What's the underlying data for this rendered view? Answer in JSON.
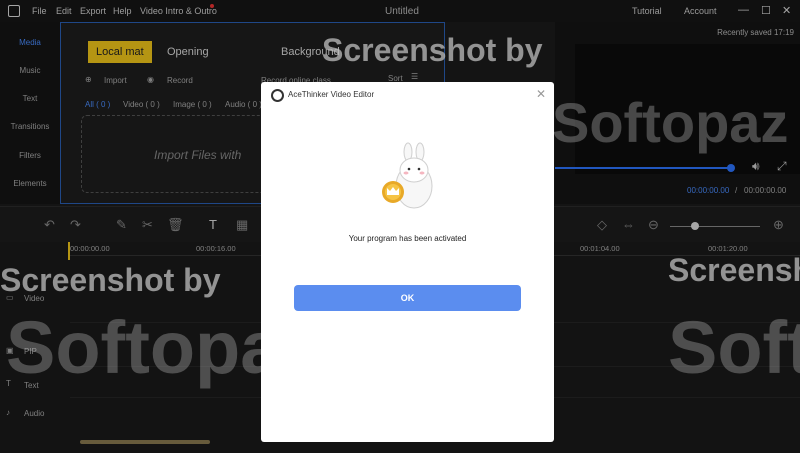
{
  "window": {
    "title": "Untitled",
    "menus": [
      "File",
      "Edit",
      "Export",
      "Help",
      "Video Intro & Outro"
    ],
    "tutorial": "Tutorial",
    "account": "Account",
    "recently_saved": "Recently saved 17:19"
  },
  "sidebar": {
    "items": [
      {
        "label": "Media",
        "active": true
      },
      {
        "label": "Music"
      },
      {
        "label": "Text"
      },
      {
        "label": "Transitions"
      },
      {
        "label": "Filters"
      },
      {
        "label": "Elements"
      }
    ]
  },
  "media": {
    "tabs": [
      "Local mat",
      "Opening",
      "Background"
    ],
    "import_label": "Import",
    "record_label": "Record",
    "record_screen_label": "Record online class",
    "sort_label": "Sort",
    "filters": [
      "All ( 0 )",
      "Video ( 0 )",
      "Image ( 0 )",
      "Audio ( 0 )"
    ],
    "import_hint": "Import Files with"
  },
  "preview": {
    "current_time": "00:00:00.00",
    "separator": "/",
    "total_time": "00:00:00.00"
  },
  "timeline": {
    "ruler": [
      "00:00:00.00",
      "00:00:16.00",
      "00:01:04.00",
      "00:01:20.00"
    ],
    "tracks": [
      "Video",
      "PIP",
      "Text",
      "Audio"
    ]
  },
  "watermark": {
    "line1": "Screenshot by",
    "line2": "Softopaz"
  },
  "dialog": {
    "title": "AceThinker Video Editor",
    "message": "Your program has been activated",
    "ok_label": "OK",
    "close_icon": "close-icon"
  },
  "colors": {
    "accent": "#f2c71a",
    "primary_button": "#5b8def",
    "progress": "#2d74ff"
  }
}
